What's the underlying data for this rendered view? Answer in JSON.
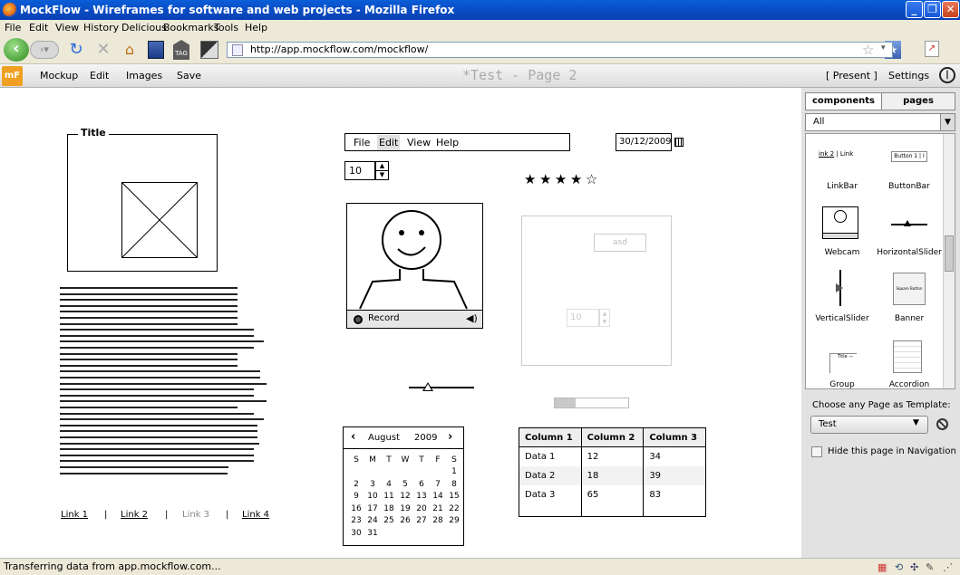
{
  "window": {
    "title": "MockFlow - Wireframes for software and web projects - Mozilla Firefox",
    "min": "_",
    "max": "❐",
    "close": "✕"
  },
  "menu": [
    "File",
    "Edit",
    "View",
    "History",
    "Delicious",
    "Bookmarks",
    "Tools",
    "Help"
  ],
  "url": "http://app.mockflow.com/mockflow/",
  "app": {
    "logo": "mF",
    "menu": [
      "Mockup",
      "Edit",
      "Images",
      "Save"
    ],
    "page_title": "*Test - Page 2",
    "present": "[ Present ]",
    "settings": "Settings"
  },
  "mock": {
    "group_title": "Title",
    "menubar": [
      "File",
      "Edit",
      "View",
      "Help"
    ],
    "date": "30/12/2009",
    "stepper": "10",
    "stars": [
      "★",
      "★",
      "★",
      "★",
      "☆"
    ],
    "webcam_record": "Record",
    "faded_field": "asd",
    "faded_stepper": "10",
    "calendar": {
      "month": "August",
      "year": "2009",
      "days": [
        "S",
        "M",
        "T",
        "W",
        "T",
        "F",
        "S"
      ],
      "rows": [
        [
          "",
          "",
          "",
          "",
          "",
          "",
          "1"
        ],
        [
          "2",
          "3",
          "4",
          "5",
          "6",
          "7",
          "8"
        ],
        [
          "9",
          "10",
          "11",
          "12",
          "13",
          "14",
          "15"
        ],
        [
          "16",
          "17",
          "18",
          "19",
          "20",
          "21",
          "22"
        ],
        [
          "23",
          "24",
          "25",
          "26",
          "27",
          "28",
          "29"
        ],
        [
          "30",
          "31",
          "",
          "",
          "",
          "",
          ""
        ]
      ]
    },
    "table": {
      "headers": [
        "Column 1",
        "Column 2",
        "Column 3"
      ],
      "rows": [
        [
          "Data 1",
          "12",
          "34"
        ],
        [
          "Data 2",
          "18",
          "39"
        ],
        [
          "Data 3",
          "65",
          "83"
        ]
      ]
    },
    "links": [
      "Link 1",
      "|",
      "Link 2",
      "|",
      "Link 3",
      "|",
      "Link 4"
    ]
  },
  "panel": {
    "tabs": [
      "components",
      "pages"
    ],
    "filter": "All",
    "components": [
      "LinkBar",
      "ButtonBar",
      "Webcam",
      "HorizontalSlider",
      "VerticalSlider",
      "Banner",
      "Group",
      "Accordion"
    ],
    "template_label": "Choose any Page as Template:",
    "template_value": "Test",
    "hide_label": "Hide this page in Navigation"
  },
  "status": "Transferring data from app.mockflow.com..."
}
